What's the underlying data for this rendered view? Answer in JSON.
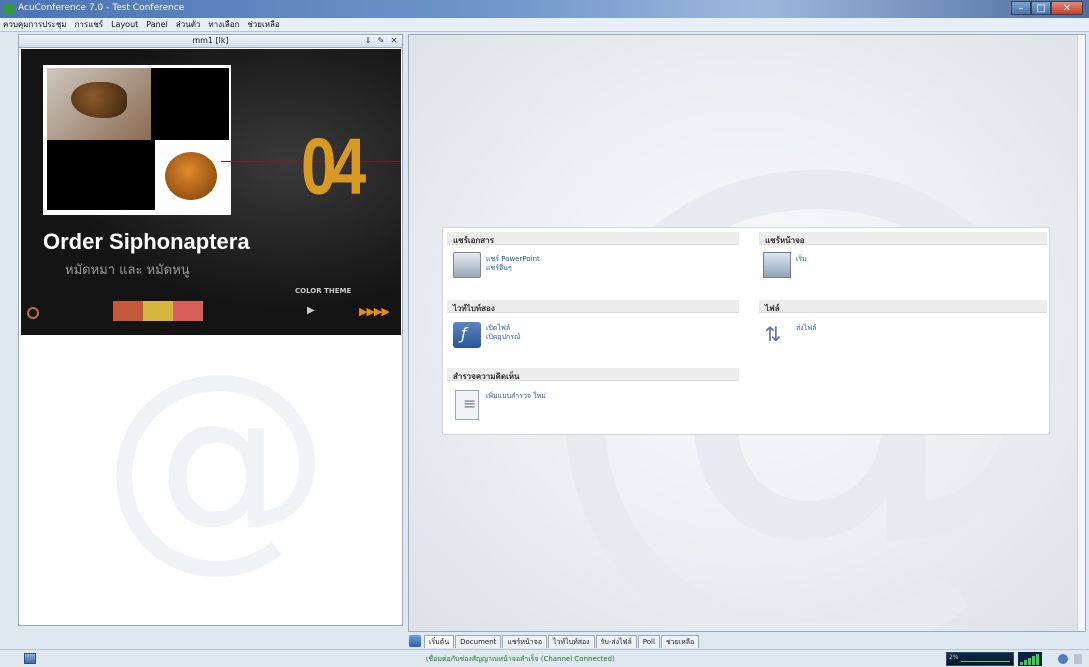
{
  "window": {
    "title": "AcuConference 7.0 - Test Conference"
  },
  "menu": [
    "ควบคุมการประชุม",
    "การแชร์",
    "Layout",
    "Panel",
    "ส่วนตัว",
    "ทางเลือก",
    "ช่วยเหลือ"
  ],
  "video_panel": {
    "participant_name": "mm1 [lk]",
    "slide": {
      "title": "Order Siphonaptera",
      "subtitle": "หมัดหมา และ หมัดหนู",
      "number": "04",
      "theme_label": "COLOR THEME",
      "arrows": "▶▶▶▶"
    }
  },
  "actions": {
    "share_docs": {
      "heading": "แชร์เอกสาร",
      "links": [
        "แชร์ PowerPoint",
        "แชร์อื่นๆ"
      ]
    },
    "share_screen": {
      "heading": "แชร์หน้าจอ",
      "links": [
        "เริ่ม"
      ]
    },
    "whiteboard": {
      "heading": "ไวท์ไบท์สอง",
      "links": [
        "เปิดไฟล์",
        "เปิดอุปกรณ์"
      ]
    },
    "files": {
      "heading": "ไฟล์",
      "links": [
        "ส่งไฟล์"
      ]
    },
    "poll": {
      "heading": "สำรวจความคิดเห็น",
      "links": [
        "เพิ่มแบบสำรวจ ใหม่"
      ]
    }
  },
  "tabs": [
    "เริ่มต้น",
    "Document",
    "แชร์หน้าจอ",
    "ไวท์ไบท์สอง",
    "รับ-ส่งไฟล์",
    "Poll",
    "ช่วยเหลือ"
  ],
  "status": {
    "message": "เชื่อมต่อกับช่องสัญญาณหน้าจอสำเร็จ (Channel Connected)",
    "cpu_label": "2%"
  },
  "colors": {
    "accent_blue": "#2857a8",
    "status_green": "#1a7a1a",
    "slide_orange": "#d89a23"
  },
  "icons": [
    "app-icon",
    "minimize-icon",
    "maximize-icon",
    "close-icon",
    "powerpoint-icon",
    "monitor-icon",
    "flash-icon",
    "poll-icon",
    "file-transfer-icon"
  ]
}
